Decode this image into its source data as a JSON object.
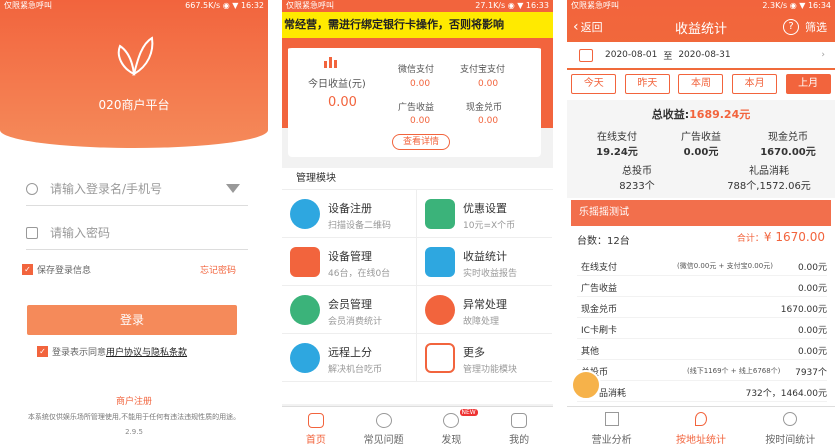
{
  "p1": {
    "status_left": "仅限紧急呼叫",
    "status_right": "667.5K/s ◉ ▼ 16:32",
    "title": "020商户平台",
    "user_placeholder": "请输入登录名/手机号",
    "pwd_placeholder": "请输入密码",
    "remember": "保存登录信息",
    "forgot": "忘记密码",
    "login": "登录",
    "agree_prefix": "登录表示同意",
    "agree_link": "用户协议与隐私条款",
    "register": "商户注册",
    "disclaimer": "本系统仅供娱乐场所管理使用,不能用于任何有违法违规性质的用途。",
    "version": "2.9.5"
  },
  "p2": {
    "status_left": "仅限紧急呼叫",
    "status_right": "27.1K/s ◉ ▼ 16:33",
    "marquee": "常经营，需进行绑定银行卡操作，否则将影响",
    "today_label": "今日收益(元)",
    "today_value": "0.00",
    "wx_label": "微信支付",
    "wx_value": "0.00",
    "zfb_label": "支付宝支付",
    "zfb_value": "0.00",
    "ad_label": "广告收益",
    "ad_value": "0.00",
    "cash_label": "现金兑币",
    "cash_value": "0.00",
    "detail": "查看详情",
    "module_title": "管理模块",
    "tiles": [
      {
        "t": "设备注册",
        "s": "扫描设备二维码"
      },
      {
        "t": "优惠设置",
        "s": "10元=X个币"
      },
      {
        "t": "设备管理",
        "s": "46台，在线0台"
      },
      {
        "t": "收益统计",
        "s": "实时收益报告"
      },
      {
        "t": "会员管理",
        "s": "会员消费统计"
      },
      {
        "t": "异常处理",
        "s": "故障处理"
      },
      {
        "t": "远程上分",
        "s": "解决机台吃币"
      },
      {
        "t": "更多",
        "s": "管理功能模块"
      }
    ],
    "tabs": [
      "首页",
      "常见问题",
      "发现",
      "我的"
    ],
    "new_badge": "NEW"
  },
  "p3": {
    "status_left": "仅限紧急呼叫",
    "status_right": "2.3K/s ◉ ▼ 16:34",
    "back": "返回",
    "title": "收益统计",
    "filter": "筛选",
    "date_from": "2020-08-01",
    "date_to_sep": "至",
    "date_to": "2020-08-31",
    "periods": [
      "今天",
      "昨天",
      "本周",
      "本月",
      "上月"
    ],
    "total_label": "总收益:",
    "total_value": "1689.24元",
    "stats": [
      {
        "l": "在线支付",
        "v": "19.24元"
      },
      {
        "l": "广告收益",
        "v": "0.00元"
      },
      {
        "l": "现金兑币",
        "v": "1670.00元"
      }
    ],
    "coin_label": "总投币",
    "coin_value": "8233个",
    "gift_label": "礼品消耗",
    "gift_value": "788个,1572.06元",
    "section": "乐摇摇测试",
    "count": "台数：12台",
    "sum_label": "合计：",
    "sum_value": "¥ 1670.00",
    "items": [
      {
        "l": "在线支付",
        "m": "(微信0.00元 + 支付宝0.00元)",
        "r": "0.00元"
      },
      {
        "l": "广告收益",
        "m": "",
        "r": "0.00元"
      },
      {
        "l": "现金兑币",
        "m": "",
        "r": "1670.00元"
      },
      {
        "l": "IC卡刷卡",
        "m": "",
        "r": "0.00元"
      },
      {
        "l": "其他",
        "m": "",
        "r": "0.00元"
      },
      {
        "l": "总投币",
        "m": "(线下1169个 + 线上6768个)",
        "r": "7937个"
      },
      {
        "l": "品消耗",
        "m": "",
        "r": "732个，1464.00元"
      }
    ],
    "tabs": [
      "营业分析",
      "按地址统计",
      "按时间统计"
    ]
  }
}
